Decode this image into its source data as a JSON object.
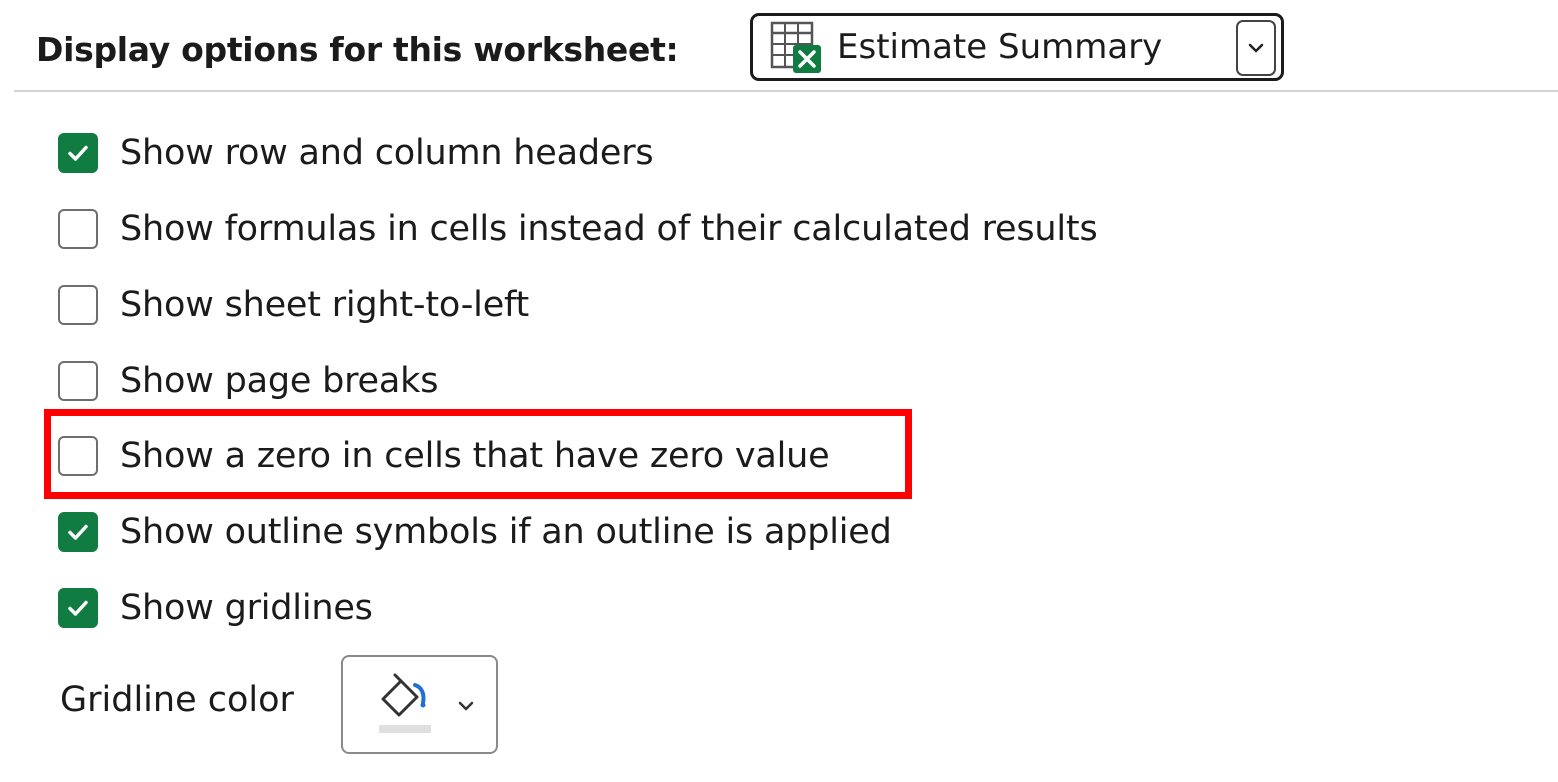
{
  "header": {
    "label": "Display options for this worksheet:",
    "sheet_select": {
      "value": "Estimate Summary",
      "icon": "excel-sheet-icon"
    }
  },
  "options": [
    {
      "label": "Show row and column headers",
      "checked": true
    },
    {
      "label": "Show formulas in cells instead of their calculated results",
      "checked": false
    },
    {
      "label": "Show sheet right-to-left",
      "checked": false
    },
    {
      "label": "Show page breaks",
      "checked": false
    },
    {
      "label": "Show a zero in cells that have zero value",
      "checked": false,
      "highlighted": true
    },
    {
      "label": "Show outline symbols if an outline is applied",
      "checked": true
    },
    {
      "label": "Show gridlines",
      "checked": true
    }
  ],
  "gridline_color": {
    "label": "Gridline color",
    "icon": "paint-bucket-icon",
    "dropdown_icon": "chevron-down-icon"
  },
  "colors": {
    "checkbox_checked": "#107c41",
    "highlight_border": "#ff0000",
    "excel_green": "#107c41"
  }
}
